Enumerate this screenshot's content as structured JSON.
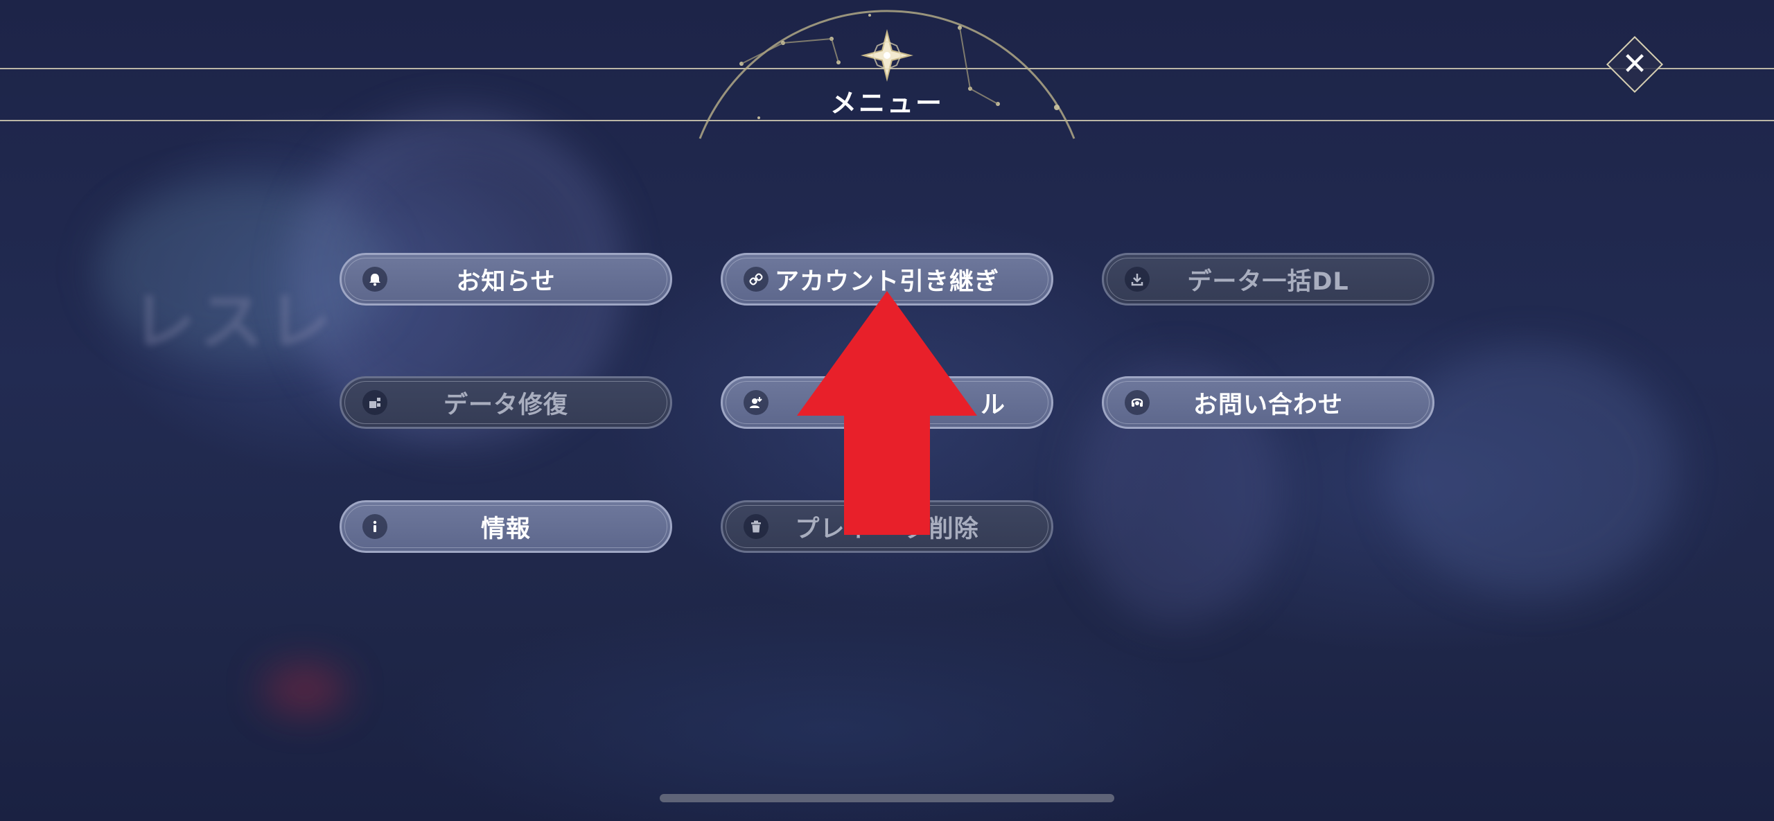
{
  "header": {
    "title": "メニュー",
    "close_symbol": "✕"
  },
  "buttons": [
    {
      "id": "notice",
      "label": "お知らせ",
      "icon": "bell-icon",
      "glyph": "🔔",
      "enabled": true
    },
    {
      "id": "account-transfer",
      "label": "アカウント引き継ぎ",
      "icon": "link-icon",
      "glyph": "⛓",
      "enabled": true
    },
    {
      "id": "bulk-download",
      "label": "データ一括DL",
      "icon": "download-icon",
      "glyph": "⤓",
      "enabled": false
    },
    {
      "id": "data-repair",
      "label": "データ修復",
      "icon": "repair-icon",
      "glyph": "▞",
      "enabled": false
    },
    {
      "id": "hidden-behind-arrow",
      "label": "ル",
      "icon": "user-icon",
      "glyph": "☗",
      "enabled": true
    },
    {
      "id": "contact",
      "label": "お問い合わせ",
      "icon": "headset-icon",
      "glyph": "☊",
      "enabled": true
    },
    {
      "id": "info",
      "label": "情報",
      "icon": "info-icon",
      "glyph": "i",
      "enabled": true
    },
    {
      "id": "delete-play-data",
      "label": "プレイ  ータ削除",
      "icon": "trash-icon",
      "glyph": "🗑",
      "enabled": false
    }
  ],
  "background": {
    "blurred_title": "レスレ",
    "blurred_subtitle": ""
  },
  "colors": {
    "annotation_arrow": "#e8202a",
    "button_active": "#6e789c",
    "button_disabled": "#3d4560",
    "gold_accent": "#d6cfb3"
  }
}
